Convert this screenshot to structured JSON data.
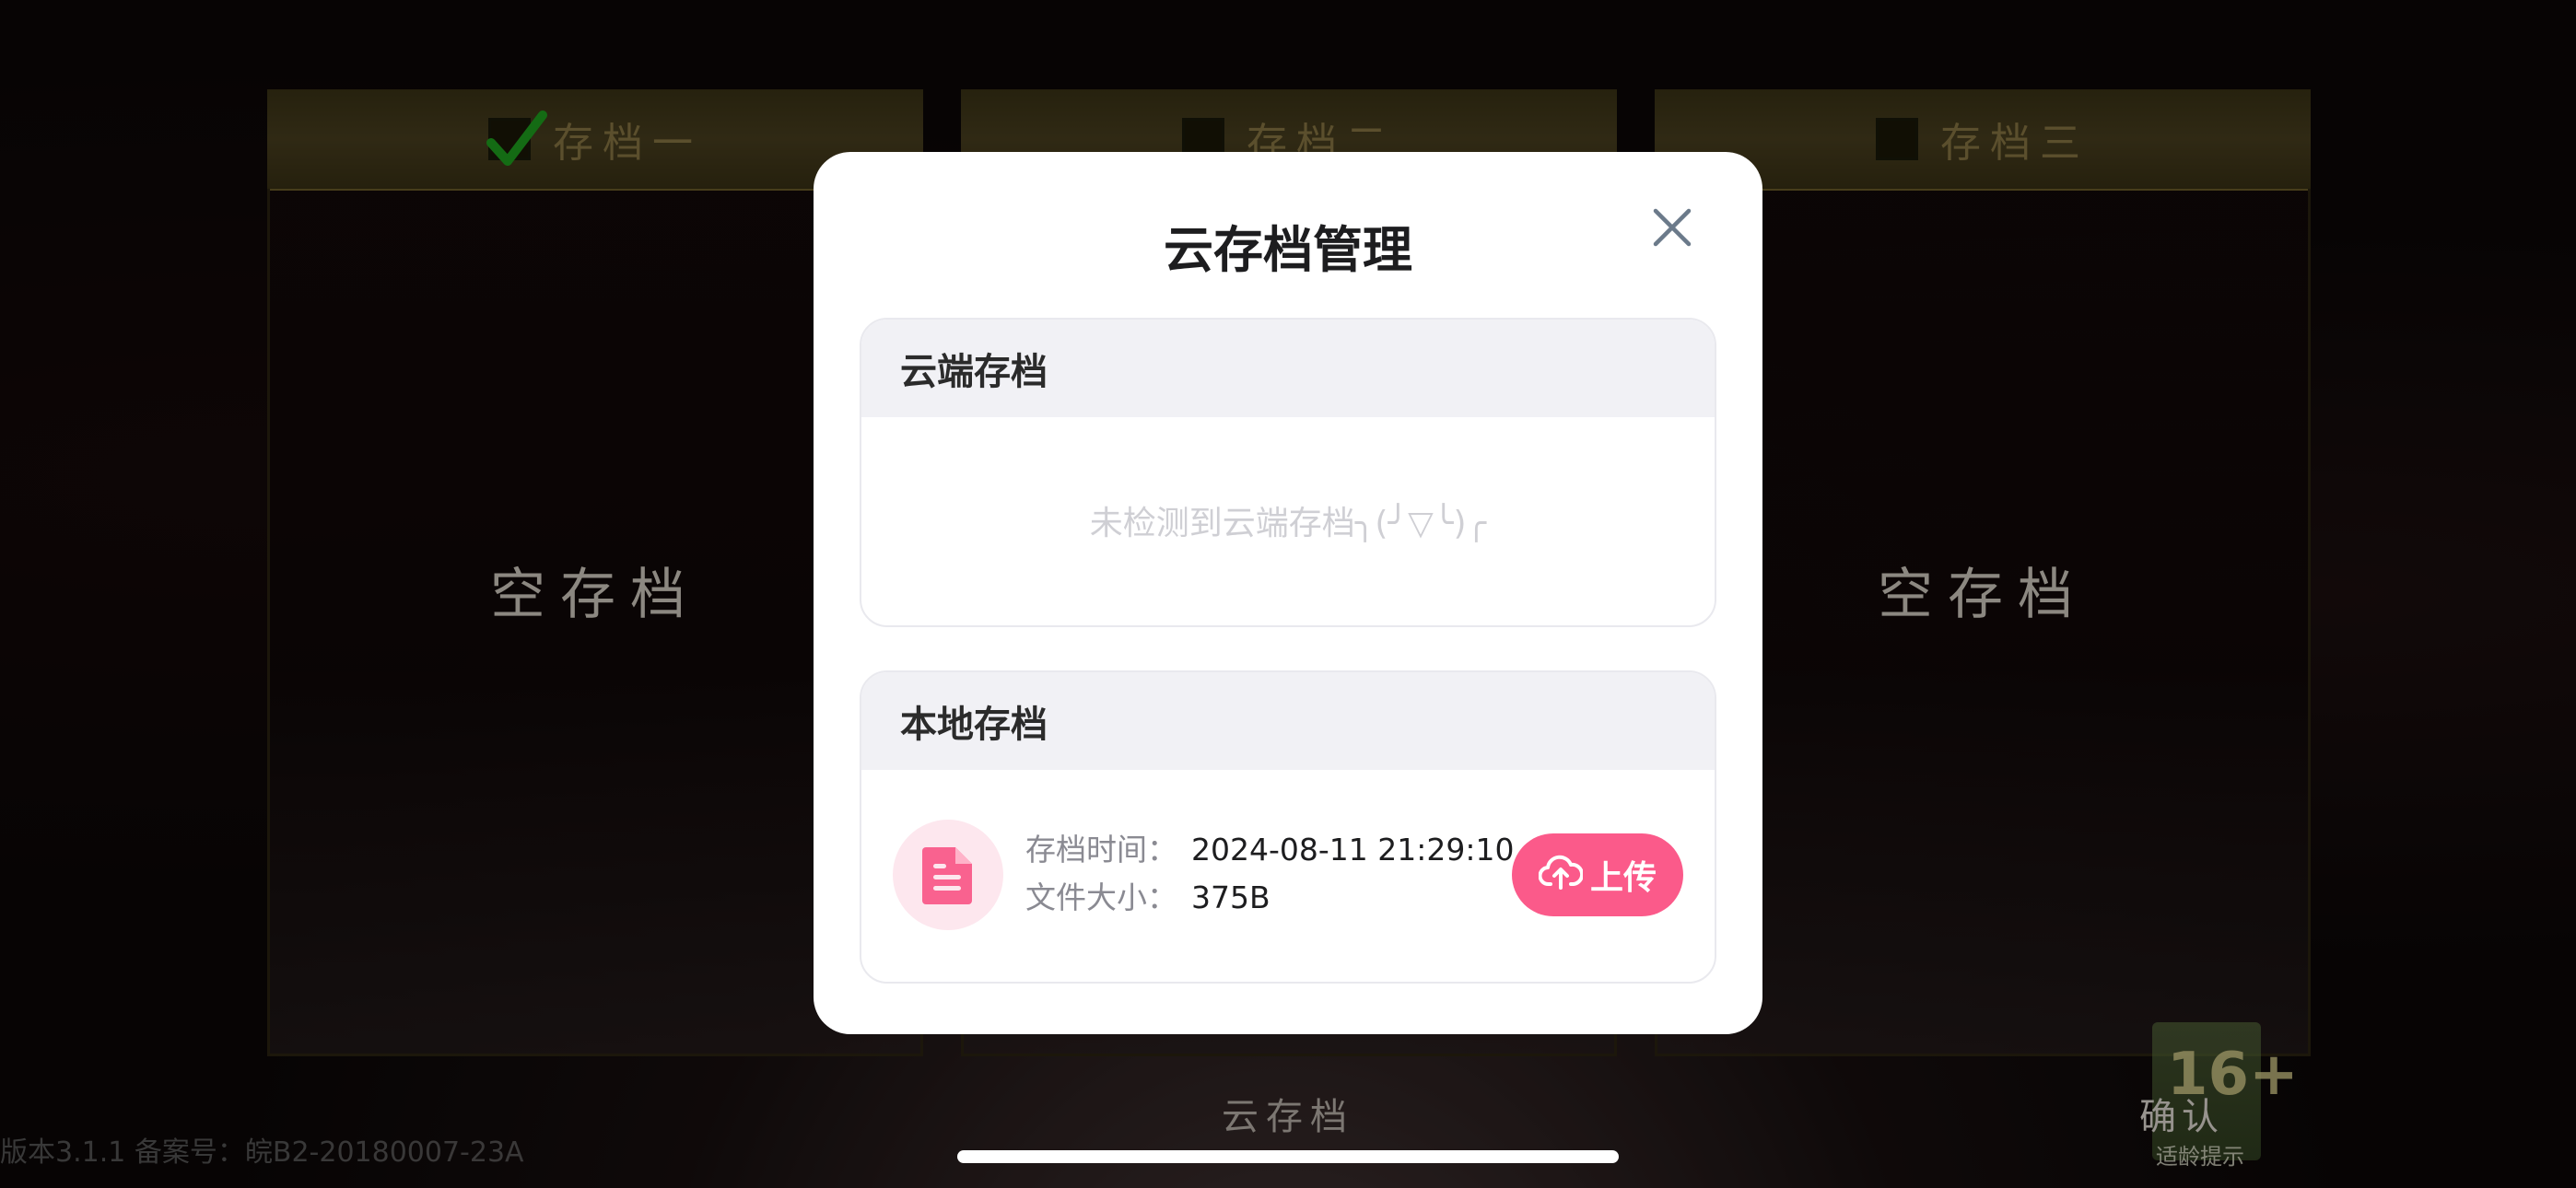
{
  "slots": [
    {
      "title": "存档一",
      "checked": true,
      "status": "空存档"
    },
    {
      "title": "存档二",
      "checked": false,
      "status": ""
    },
    {
      "title": "存档三",
      "checked": false,
      "status": "空存档"
    }
  ],
  "footer": {
    "cloud_label": "云存档",
    "confirm_label": "确认",
    "version_text": "版本3.1.1   备案号：皖B2-20180007-23A",
    "age_rating": "16+",
    "age_tip": "适龄提示"
  },
  "modal": {
    "title": "云存档管理",
    "close_icon": "close-icon",
    "cloud_section": {
      "header": "云端存档",
      "empty_message": "未检测到云端存档╮(╯▽╰)╭"
    },
    "local_section": {
      "header": "本地存档",
      "icon": "document-icon",
      "time_label": "存档时间：",
      "time_value": "2024-08-11 21:29:10",
      "size_label": "文件大小：",
      "size_value": "375B",
      "upload_label": "上传",
      "upload_icon": "cloud-upload-icon"
    }
  },
  "colors": {
    "accent": "#fb5a8a",
    "accent_light": "#fde7ee",
    "card_header_bg": "#f1f1f5"
  }
}
